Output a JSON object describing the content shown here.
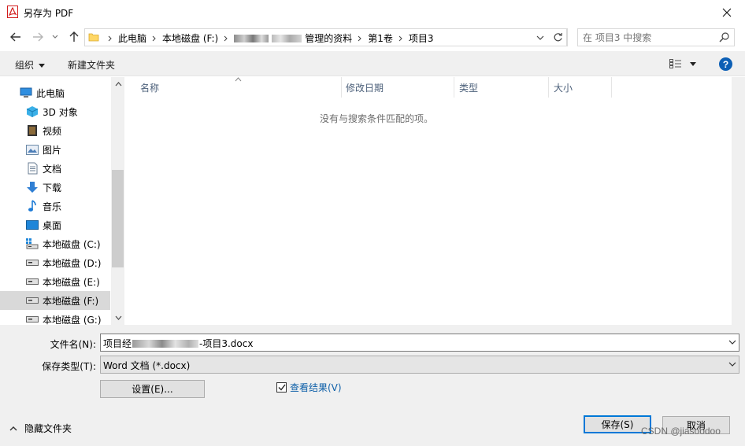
{
  "window": {
    "title": "另存为 PDF",
    "close_glyph": "✕"
  },
  "nav": {
    "back_icon": "arrow-left-icon",
    "forward_icon": "arrow-right-icon",
    "recent_icon": "chevron-down-icon",
    "up_icon": "arrow-up-icon"
  },
  "address": {
    "crumbs": [
      "此电脑",
      "本地磁盘 (F:)",
      "管理的资料",
      "第1卷",
      "项目3"
    ],
    "refresh_icon": "refresh-icon"
  },
  "search": {
    "placeholder": "在 项目3 中搜索",
    "icon": "search-icon"
  },
  "toolbar": {
    "organize_label": "组织",
    "new_folder_label": "新建文件夹",
    "view_icon": "view-details-icon",
    "help_label": "?"
  },
  "navpane": {
    "items": [
      {
        "label": "此电脑",
        "icon": "computer-icon"
      },
      {
        "label": "3D 对象",
        "icon": "cube-3d-icon"
      },
      {
        "label": "视频",
        "icon": "video-icon"
      },
      {
        "label": "图片",
        "icon": "picture-icon"
      },
      {
        "label": "文档",
        "icon": "document-icon"
      },
      {
        "label": "下载",
        "icon": "download-icon"
      },
      {
        "label": "音乐",
        "icon": "music-icon"
      },
      {
        "label": "桌面",
        "icon": "desktop-icon"
      },
      {
        "label": "本地磁盘 (C:)",
        "icon": "drive-c-icon"
      },
      {
        "label": "本地磁盘 (D:)",
        "icon": "drive-icon"
      },
      {
        "label": "本地磁盘 (E:)",
        "icon": "drive-icon"
      },
      {
        "label": "本地磁盘 (F:)",
        "icon": "drive-icon",
        "selected": true
      },
      {
        "label": "本地磁盘 (G:)",
        "icon": "drive-icon"
      }
    ]
  },
  "filelist": {
    "columns": [
      "名称",
      "修改日期",
      "类型",
      "大小"
    ],
    "empty_message": "没有与搜索条件匹配的项。"
  },
  "form": {
    "filename_label": "文件名(N):",
    "filename_prefix": "项目经",
    "filename_suffix": "-项目3.docx",
    "filetype_label": "保存类型(T):",
    "filetype_value": "Word 文档 (*.docx)",
    "settings_button": "设置(E)...",
    "view_result_label": "查看结果(V)",
    "view_result_checked": true,
    "hide_folders_label": "隐藏文件夹",
    "save_button": "保存(S)",
    "cancel_button": "取消"
  },
  "watermark": "CSDN @jiasoodoo",
  "colors": {
    "accent": "#0078d7",
    "help": "#0c5fb5",
    "link": "#0d5fa8"
  }
}
